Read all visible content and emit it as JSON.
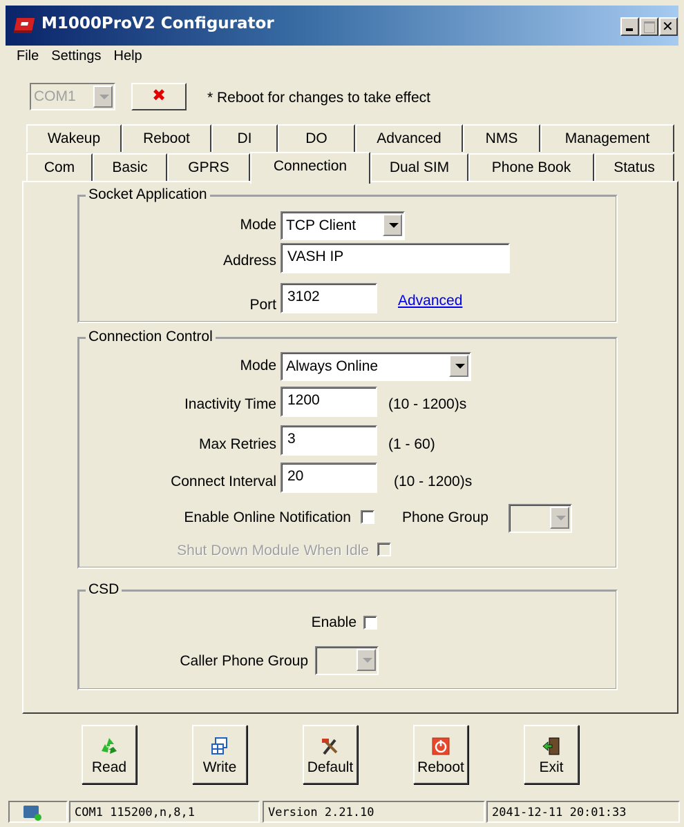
{
  "window": {
    "title": "M1000ProV2 Configurator"
  },
  "menu": [
    "File",
    "Settings",
    "Help"
  ],
  "toolbar": {
    "com_port": "COM1",
    "disconnect_label": "✖",
    "reboot_note": "* Reboot for changes to take effect"
  },
  "tabs_row1": [
    "Wakeup",
    "Reboot",
    "DI",
    "DO",
    "Advanced",
    "NMS",
    "Management"
  ],
  "tabs_row2": [
    "Com",
    "Basic",
    "GPRS",
    "Connection",
    "Dual SIM",
    "Phone Book",
    "Status"
  ],
  "active_tab": "Connection",
  "socket": {
    "legend": "Socket Application",
    "mode_label": "Mode",
    "mode_value": "TCP Client",
    "address_label": "Address",
    "address_value": "VASH IP",
    "port_label": "Port",
    "port_value": "3102",
    "advanced_link": "Advanced"
  },
  "control": {
    "legend": "Connection Control",
    "mode_label": "Mode",
    "mode_value": "Always Online",
    "inactivity_label": "Inactivity Time",
    "inactivity_value": "1200",
    "inactivity_range": "(10 - 1200)s",
    "retries_label": "Max Retries",
    "retries_value": "3",
    "retries_range": "(1 - 60)",
    "interval_label": "Connect Interval",
    "interval_value": "20",
    "interval_range": "(10 - 1200)s",
    "notification_label": "Enable Online Notification",
    "phone_group_label": "Phone Group",
    "shutdown_label": "Shut Down Module When Idle"
  },
  "csd": {
    "legend": "CSD",
    "enable_label": "Enable",
    "caller_group_label": "Caller Phone Group"
  },
  "buttons": {
    "read": "Read",
    "write": "Write",
    "default": "Default",
    "reboot": "Reboot",
    "exit": "Exit"
  },
  "status": {
    "port": "COM1 115200,n,8,1",
    "version": "Version 2.21.10",
    "datetime": "2041-12-11 20:01:33"
  }
}
